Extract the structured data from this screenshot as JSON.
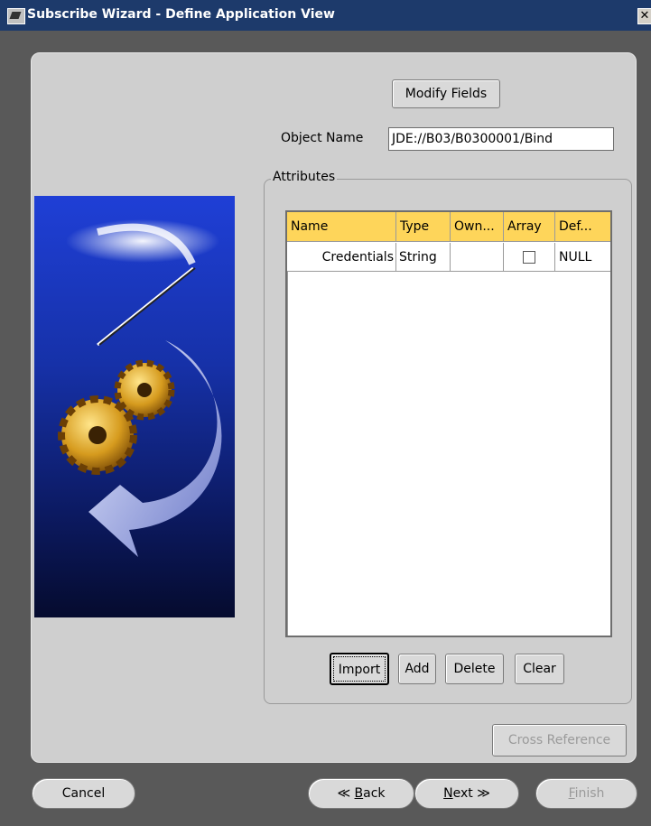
{
  "window": {
    "title": "Subscribe Wizard  - Define Application View",
    "close_glyph": "✕"
  },
  "form": {
    "modify_fields_label": "Modify Fields",
    "object_name_label": "Object Name",
    "object_name_value": "JDE://B03/B0300001/Bind",
    "attributes_group_label": "Attributes"
  },
  "table": {
    "columns": [
      "Name",
      "Type",
      "Own...",
      "Array",
      "Def..."
    ],
    "rows": [
      {
        "name": "Credentials",
        "type": "String",
        "owner": "",
        "array": false,
        "default": "NULL"
      }
    ]
  },
  "table_buttons": {
    "import": "Import",
    "add": "Add",
    "delete": "Delete",
    "clear": "Clear"
  },
  "cross_reference_label": "Cross Reference",
  "nav": {
    "cancel": "Cancel",
    "back_glyph": "≪",
    "back_underlined": "B",
    "back_rest": "ack",
    "next_underlined": "N",
    "next_rest": "ext",
    "next_glyph": "≫",
    "finish_underlined": "F",
    "finish_rest": "inish"
  },
  "icons": {
    "app": "wizard-app-icon",
    "close": "close-icon",
    "illustration": "gears-wand-arrow-illustration"
  },
  "colors": {
    "titlebar": "#1d3a6b",
    "table_header": "#fed55a",
    "panel": "#cfcfcf",
    "illustration_top": "#1f3fd6",
    "illustration_bottom": "#050b2e"
  }
}
